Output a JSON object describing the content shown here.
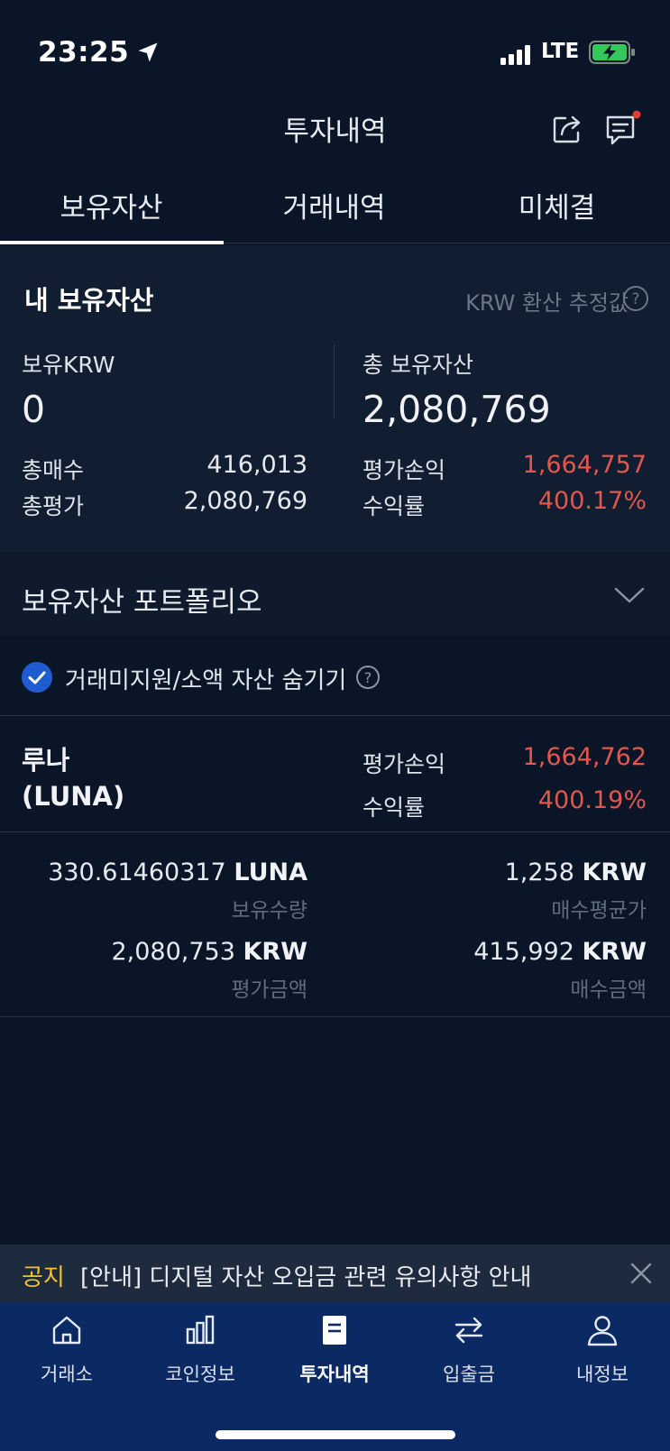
{
  "status_bar": {
    "time": "23:25",
    "network": "LTE"
  },
  "header": {
    "title": "투자내역"
  },
  "tabs": [
    {
      "label": "보유자산",
      "active": true
    },
    {
      "label": "거래내역",
      "active": false
    },
    {
      "label": "미체결",
      "active": false
    }
  ],
  "summary": {
    "title": "내 보유자산",
    "krw_note": "KRW 환산 추정값",
    "krw_label": "보유KRW",
    "krw_value": "0",
    "total_label": "총 보유자산",
    "total_value": "2,080,769",
    "total_buy_label": "총매수",
    "total_buy_value": "416,013",
    "total_eval_label": "총평가",
    "total_eval_value": "2,080,769",
    "pnl_label": "평가손익",
    "pnl_value": "1,664,757",
    "roi_label": "수익률",
    "roi_value": "400.17%"
  },
  "portfolio": {
    "title": "보유자산 포트폴리오"
  },
  "filter": {
    "label": "거래미지원/소액 자산 숨기기",
    "checked": true
  },
  "asset": {
    "name": "루나",
    "symbol": "(LUNA)",
    "pnl_label": "평가손익",
    "pnl_value": "1,664,762",
    "roi_label": "수익률",
    "roi_value": "400.19%",
    "qty_value": "330.61460317",
    "qty_unit": "LUNA",
    "qty_label": "보유수량",
    "avg_value": "1,258",
    "avg_unit": "KRW",
    "avg_label": "매수평균가",
    "eval_value": "2,080,753",
    "eval_unit": "KRW",
    "eval_label": "평가금액",
    "buy_value": "415,992",
    "buy_unit": "KRW",
    "buy_label": "매수금액"
  },
  "notice": {
    "tag": "공지",
    "text": "[안내] 디지털 자산 오입금 관련 유의사항 안내"
  },
  "nav": [
    {
      "label": "거래소",
      "icon": "home-icon",
      "active": false
    },
    {
      "label": "코인정보",
      "icon": "bar-chart-icon",
      "active": false
    },
    {
      "label": "투자내역",
      "icon": "document-icon",
      "active": true
    },
    {
      "label": "입출금",
      "icon": "transfer-icon",
      "active": false
    },
    {
      "label": "내정보",
      "icon": "user-icon",
      "active": false
    }
  ],
  "colors": {
    "background": "#0a1628",
    "gain": "#e2574c",
    "nav": "#0b2a64",
    "notice_tag": "#f2c230",
    "check": "#1f5cd1"
  }
}
